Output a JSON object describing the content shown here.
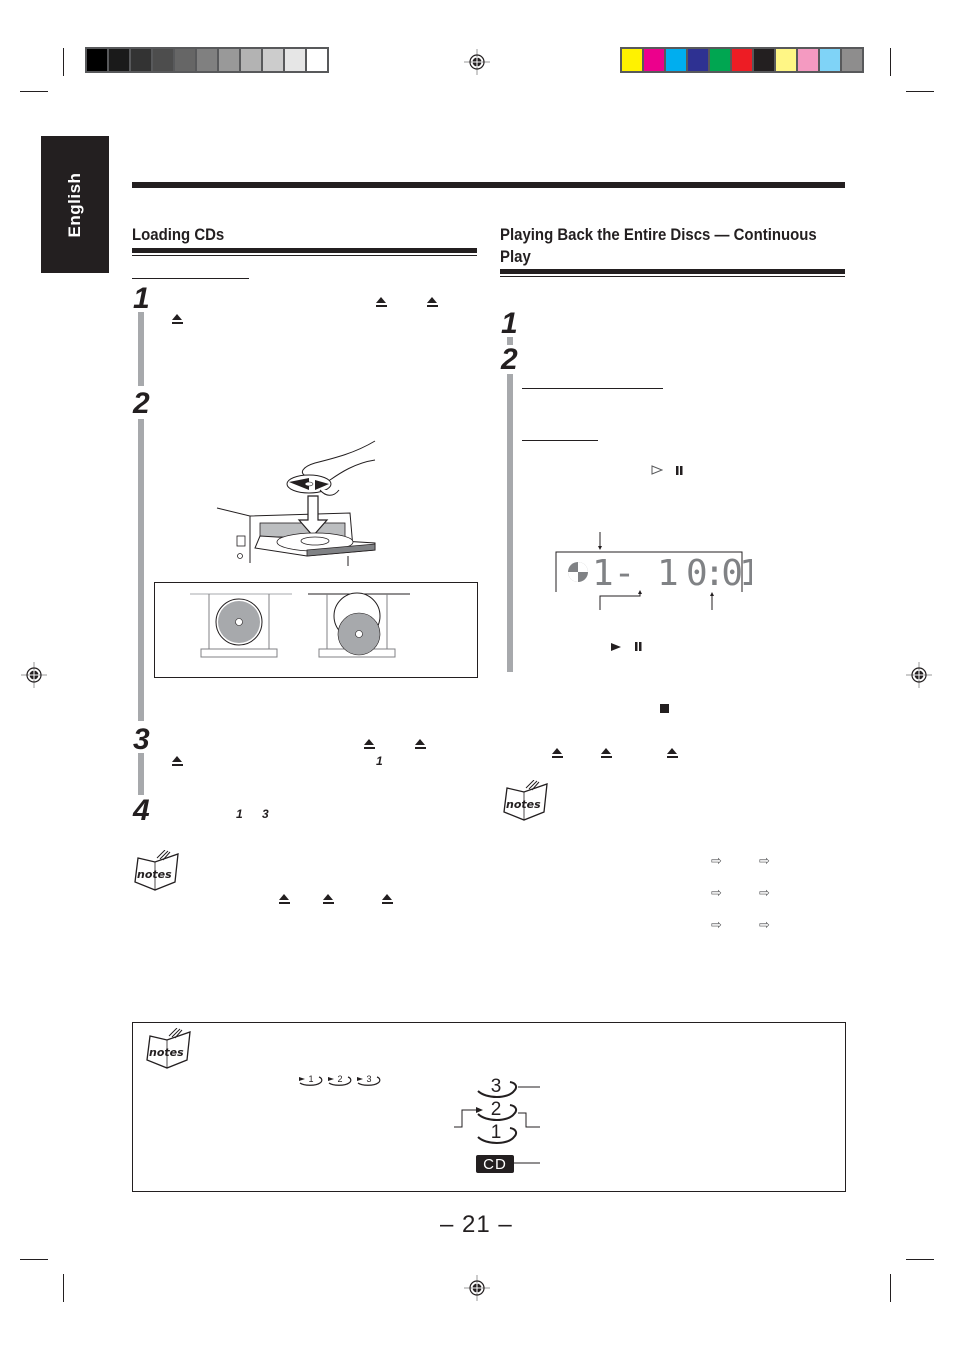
{
  "color_bars": {
    "grayscale": [
      "#000000",
      "#1a1a1a",
      "#333333",
      "#4d4d4d",
      "#666666",
      "#808080",
      "#999999",
      "#b3b3b3",
      "#cccccc",
      "#e6e6e6",
      "#ffffff"
    ],
    "process": [
      "#fff200",
      "#ec008c",
      "#00aeef",
      "#2e3192",
      "#00a651",
      "#ed1c24",
      "#231f20",
      "#fff685",
      "#f49ac1",
      "#7fd3f7",
      "#8e8d8d"
    ]
  },
  "language_tab": "English",
  "left_section": {
    "title": "Loading CDs",
    "steps": [
      {
        "number": "1"
      },
      {
        "number": "2"
      },
      {
        "number": "3",
        "inline_ref": "1"
      },
      {
        "number": "4",
        "inline_refs": [
          "1",
          "3"
        ]
      }
    ],
    "icons": {
      "eject": "eject-icon",
      "notes": "notes-icon"
    }
  },
  "right_section": {
    "title": "Playing Back the Entire Discs — Continuous Play",
    "steps": [
      {
        "number": "1"
      },
      {
        "number": "2"
      }
    ],
    "display": {
      "disc_track": "1- 1",
      "time": "0:01"
    },
    "icons": {
      "play_outline": "play-outline-icon",
      "pause": "pause-icon",
      "play": "play-icon",
      "stop": "stop-icon",
      "eject": "eject-icon",
      "arrow": "arrow-right-icon",
      "notes": "notes-icon"
    }
  },
  "bottom_notes": {
    "inline_discs": [
      "1",
      "2",
      "3"
    ],
    "disc_indicator": [
      "3",
      "2",
      "1"
    ],
    "cd_label": "CD"
  },
  "page_number": "– 21 –"
}
